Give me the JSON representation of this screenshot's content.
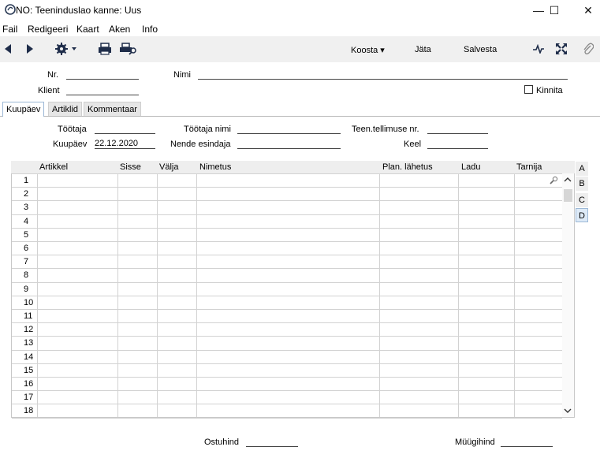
{
  "window": {
    "title": "NO: Teeninduslao kanne: Uus",
    "minimize": "—",
    "maximize": "☐",
    "close": "✕"
  },
  "menu": [
    "Fail",
    "Redigeeri",
    "Kaart",
    "Aken",
    "Info"
  ],
  "toolbar": {
    "koosta": "Koosta ▾",
    "jata": "Jäta",
    "salvesta": "Salvesta"
  },
  "header": {
    "nr_label": "Nr.",
    "nr_value": "",
    "nimi_label": "Nimi",
    "nimi_value": "",
    "klient_label": "Klient",
    "klient_value": "",
    "kinnita_label": "Kinnita"
  },
  "tabs": [
    "Kuupäev",
    "Artiklid",
    "Kommentaar"
  ],
  "form": {
    "tootaja_label": "Töötaja",
    "tootaja_value": "",
    "tootaja_nimi_label": "Töötaja nimi",
    "tootaja_nimi_value": "",
    "teen_label": "Teen.tellimuse nr.",
    "teen_value": "",
    "kuupaev_label": "Kuupäev",
    "kuupaev_value": "22.12.2020",
    "nende_label": "Nende esindaja",
    "nende_value": "",
    "keel_label": "Keel",
    "keel_value": ""
  },
  "grid": {
    "columns": [
      "Artikkel",
      "Sisse",
      "Välja",
      "Nimetus",
      "Plan. lähetus",
      "Ladu",
      "Tarnija"
    ],
    "rows": [
      "1",
      "2",
      "3",
      "4",
      "5",
      "6",
      "7",
      "8",
      "9",
      "10",
      "11",
      "12",
      "13",
      "14",
      "15",
      "16",
      "17",
      "18"
    ]
  },
  "side_tabs": [
    "A",
    "B",
    "C",
    "D"
  ],
  "footer": {
    "ostuhind_label": "Ostuhind",
    "ostuhind_value": "",
    "muugihind_label": "Müügihind",
    "muugihind_value": ""
  },
  "colors": {
    "tab_active_border": "#9cb8d6",
    "side_tab_active": "#ddeaf7"
  }
}
